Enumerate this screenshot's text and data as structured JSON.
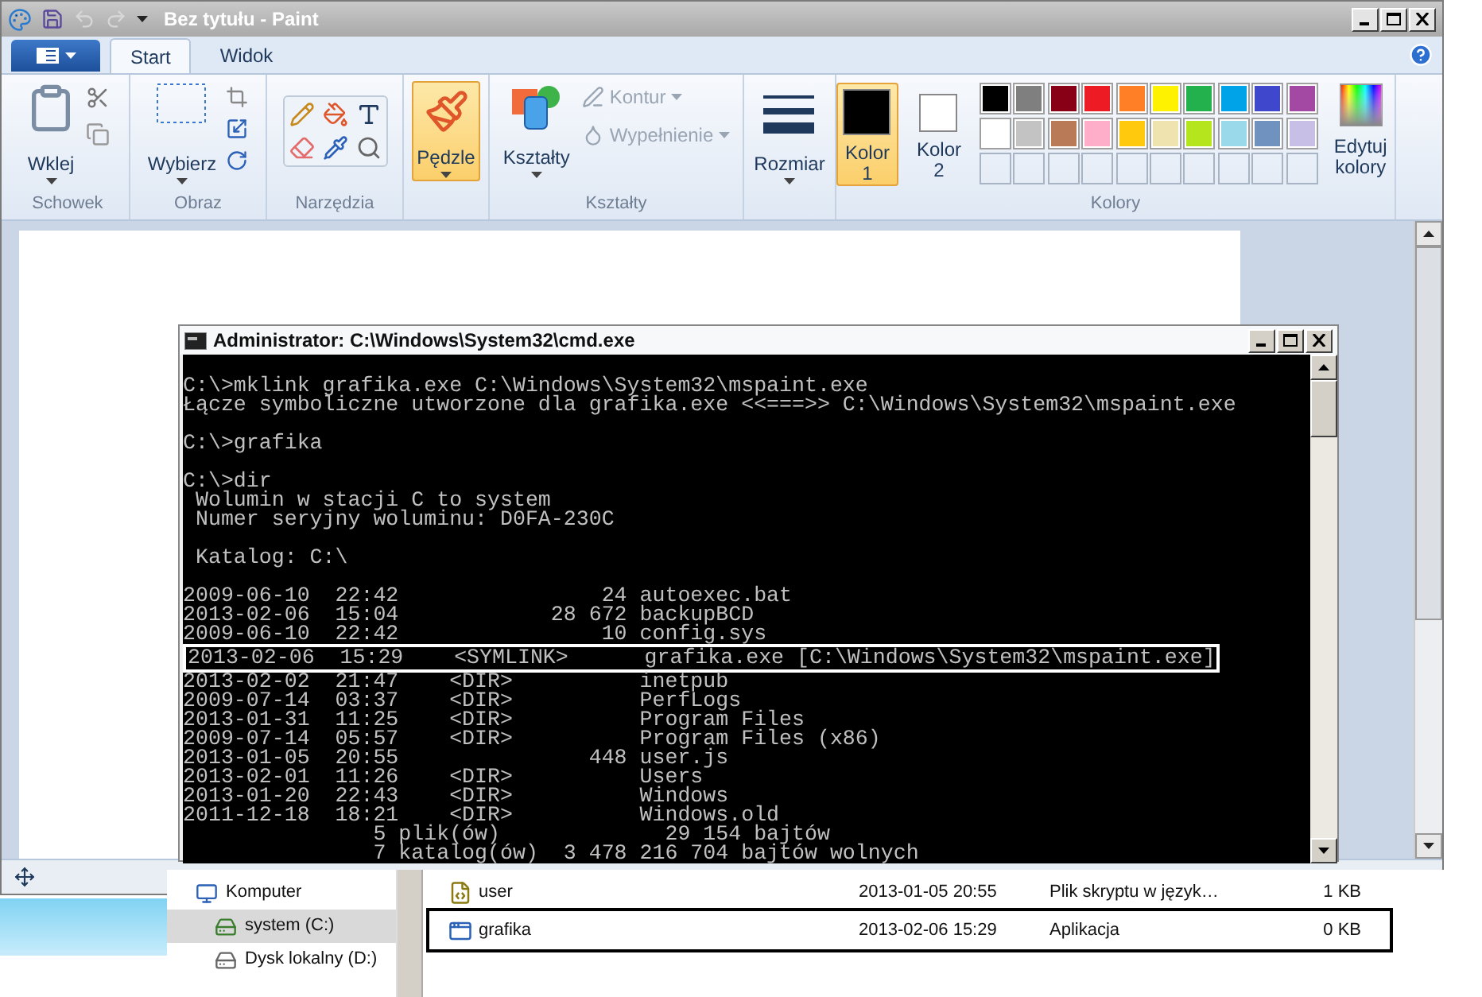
{
  "paint": {
    "title": "Bez tytułu - Paint",
    "tabs": [
      {
        "label": "Start",
        "selected": true
      },
      {
        "label": "Widok",
        "selected": false
      }
    ],
    "clipboard": {
      "label": "Schowek",
      "paste": "Wklej"
    },
    "image": {
      "label": "Obraz",
      "select": "Wybierz"
    },
    "tools": {
      "label": "Narzędzia"
    },
    "brushes": {
      "label": "Pędzle",
      "selected": true
    },
    "shapes": {
      "label": "Kształty",
      "button": "Kształty",
      "options": [
        {
          "label": "Kontur",
          "disabled": true
        },
        {
          "label": "Wypełnienie",
          "disabled": true
        }
      ]
    },
    "size": {
      "label": "Rozmiar"
    },
    "colors": {
      "label": "Kolory",
      "slots": [
        {
          "label": "Kolor",
          "number": "1",
          "color": "#000000",
          "selected": true
        },
        {
          "label": "Kolor",
          "number": "2",
          "color": "#ffffff",
          "selected": false
        }
      ],
      "palette": [
        {
          "color": "#000000"
        },
        {
          "color": "#7f7f7f"
        },
        {
          "color": "#880015"
        },
        {
          "color": "#ed1c24"
        },
        {
          "color": "#ff7f27"
        },
        {
          "color": "#fff200"
        },
        {
          "color": "#22b14c"
        },
        {
          "color": "#00a2e8"
        },
        {
          "color": "#3f48cc"
        },
        {
          "color": "#a349a4"
        },
        {
          "color": "#ffffff"
        },
        {
          "color": "#c3c3c3"
        },
        {
          "color": "#b97a57"
        },
        {
          "color": "#ffaec9"
        },
        {
          "color": "#ffc90e"
        },
        {
          "color": "#efe4b0"
        },
        {
          "color": "#b5e61d"
        },
        {
          "color": "#99d9ea"
        },
        {
          "color": "#7092be"
        },
        {
          "color": "#c8bfe7"
        }
      ],
      "edit": "Edytuj kolory"
    }
  },
  "cmd": {
    "title": "Administrator: C:\\Windows\\System32\\cmd.exe",
    "blocks": [
      {
        "lines": [
          {
            "text": "C:\\>mklink grafika.exe C:\\Windows\\System32\\mspaint.exe",
            "highlighted": false
          },
          {
            "text": "Łącze symboliczne utworzone dla grafika.exe <<===>> C:\\Windows\\System32\\mspaint.exe",
            "highlighted": false
          }
        ]
      },
      {
        "lines": [
          {
            "text": "C:\\>grafika",
            "highlighted": false
          }
        ]
      },
      {
        "lines": [
          {
            "text": "C:\\>dir",
            "highlighted": false
          },
          {
            "text": " Wolumin w stacji C to system",
            "highlighted": false
          },
          {
            "text": " Numer seryjny woluminu: D0FA-230C",
            "highlighted": false
          }
        ]
      },
      {
        "lines": [
          {
            "text": " Katalog: C:\\",
            "highlighted": false
          }
        ]
      },
      {
        "lines": [
          {
            "text": "2009-06-10  22:42                24 autoexec.bat",
            "highlighted": false
          },
          {
            "text": "2013-02-06  15:04            28 672 backupBCD",
            "highlighted": false
          },
          {
            "text": "2009-06-10  22:42                10 config.sys",
            "highlighted": false
          },
          {
            "text": "2013-02-06  15:29    <SYMLINK>      grafika.exe [C:\\Windows\\System32\\mspaint.exe]",
            "highlighted": true
          },
          {
            "text": "2013-02-02  21:47    <DIR>          inetpub",
            "highlighted": false
          },
          {
            "text": "2009-07-14  03:37    <DIR>          PerfLogs",
            "highlighted": false
          },
          {
            "text": "2013-01-31  11:25    <DIR>          Program Files",
            "highlighted": false
          },
          {
            "text": "2009-07-14  05:57    <DIR>          Program Files (x86)",
            "highlighted": false
          },
          {
            "text": "2013-01-05  20:55               448 user.js",
            "highlighted": false
          },
          {
            "text": "2013-02-01  11:26    <DIR>          Users",
            "highlighted": false
          },
          {
            "text": "2013-01-20  22:43    <DIR>          Windows",
            "highlighted": false
          },
          {
            "text": "2011-12-18  18:21    <DIR>          Windows.old",
            "highlighted": false
          },
          {
            "text": "               5 plik(ów)             29 154 bajtów",
            "highlighted": false
          },
          {
            "text": "               7 katalog(ów)  3 478 216 704 bajtów wolnych",
            "highlighted": false
          }
        ]
      }
    ]
  },
  "explorer": {
    "nav": [
      {
        "label": "Komputer",
        "kind": "computer",
        "selected": false
      },
      {
        "label": "system (C:)",
        "kind": "system-drive",
        "selected": true
      },
      {
        "label": "Dysk lokalny (D:)",
        "kind": "drive",
        "selected": false
      }
    ],
    "files": [
      {
        "name": "user",
        "kind": "script",
        "date": "2013-01-05 20:55",
        "type": "Plik skryptu w język…",
        "size": "1 KB",
        "highlighted": false
      },
      {
        "name": "grafika",
        "kind": "app",
        "date": "2013-02-06 15:29",
        "type": "Aplikacja",
        "size": "0 KB",
        "highlighted": true
      }
    ]
  }
}
